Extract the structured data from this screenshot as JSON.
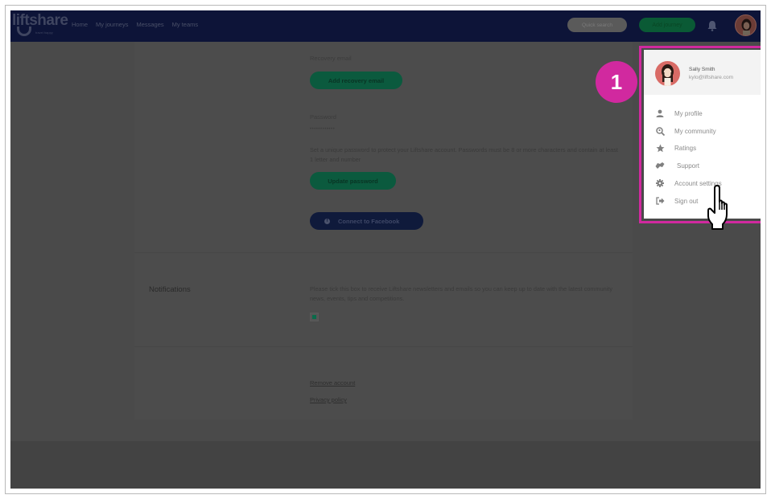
{
  "app": {
    "logo_text": "liftshare",
    "logo_tagline": "travel happy"
  },
  "nav": {
    "items": [
      "Home",
      "My journeys",
      "Messages",
      "My teams"
    ],
    "quick_search_label": "Quick search",
    "add_journey_label": "Add journey"
  },
  "security": {
    "recovery_email_label": "Recovery email",
    "add_recovery_email_button": "Add recovery email",
    "password_label": "Password",
    "password_value": "••••••••••••",
    "password_help": "Set a unique password to protect your Liftshare account. Passwords must be 8 or more characters and contain at least 1 letter and number",
    "update_password_button": "Update password",
    "connect_facebook_button": "Connect to Facebook"
  },
  "notifications": {
    "heading": "Notifications",
    "description": "Please tick this box to receive Liftshare newsletters and emails so you can keep up to date with the latest community news, events, tips and competitions.",
    "checked": true
  },
  "footer_links": {
    "remove_account": "Remove account",
    "privacy_policy": "Privacy policy"
  },
  "annotation": {
    "step_number": "1",
    "highlight_color": "#d1299f"
  },
  "user_menu": {
    "name": "Sally Smith",
    "email": "kylo@liftshare.com",
    "items": [
      {
        "label": "My profile",
        "icon": "user-icon"
      },
      {
        "label": "My community",
        "icon": "search-community-icon"
      },
      {
        "label": "Ratings",
        "icon": "star-icon"
      },
      {
        "label": "Support",
        "icon": "handshake-icon"
      },
      {
        "label": "Account settings",
        "icon": "gear-icon"
      },
      {
        "label": "Sign out",
        "icon": "sign-out-icon"
      }
    ]
  },
  "colors": {
    "navbar": "#0d1438",
    "accent_green": "#0b5a3e",
    "facebook": "#0f1a3b",
    "overlay_bg": "#4a4a4a"
  }
}
